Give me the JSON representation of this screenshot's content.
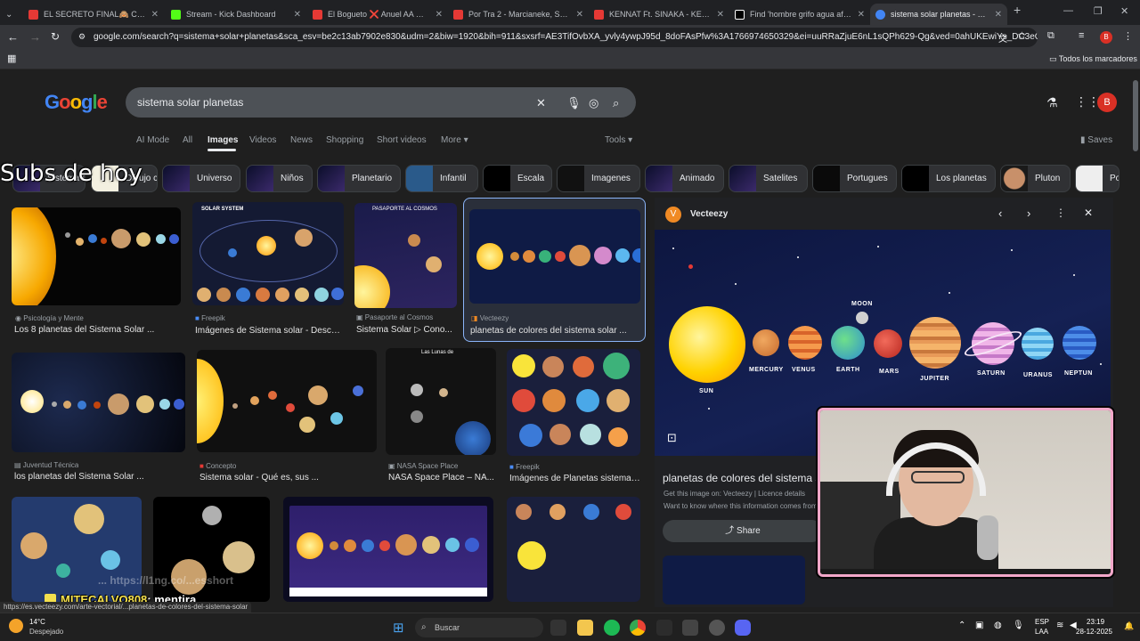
{
  "tabs": [
    {
      "title": "EL SECRETO FINAL🙈 Capítulo",
      "color": "#e53935"
    },
    {
      "title": "Stream - Kick Dashboard",
      "color": "#53fc18"
    },
    {
      "title": "El Bogueto ❌ Anuel AA ❌ Yu",
      "color": "#e53935"
    },
    {
      "title": "Por Tra 2 - Marcianeke, SexyZu",
      "color": "#e53935"
    },
    {
      "title": "KENNAT Ft. SINAKA - KE KE (Vi",
      "color": "#e53935"
    },
    {
      "title": "Find 'hombre grifo agua africa",
      "color": "#ffffff"
    },
    {
      "title": "sistema solar planetas - Google",
      "color": "#4285f4"
    }
  ],
  "url": "google.com/search?q=sistema+solar+planetas&sca_esv=be2c13ab7902e830&udm=2&biw=1920&bih=911&sxsrf=AE3TifOvbXA_yvly4ywpJ95d_8doFAsPfw%3A1766974650329&ei=uuRRaZjuE6nL1sQPh629-Qg&ved=0ahUKEwiYs_DC3eGRAxW...",
  "bookmarks_label": "Todos los marcadores",
  "logo": "Google",
  "search": {
    "query": "sistema solar planetas"
  },
  "nav": {
    "items": [
      "AI Mode",
      "All",
      "Images",
      "Videos",
      "News",
      "Shopping",
      "Short videos",
      "More"
    ],
    "tools": "Tools",
    "saves": "Saves"
  },
  "chips": [
    "Sistema solar",
    "Dibujo color",
    "Universo",
    "Niños",
    "Planetario",
    "Infantil",
    "Escala",
    "Imagenes",
    "Animado",
    "Satelites",
    "Portugues",
    "Los planetas",
    "Pluton",
    "Po"
  ],
  "results": [
    {
      "source": "Psicología y Mente",
      "caption": "Los 8 planetas del Sistema Solar ..."
    },
    {
      "source": "Freepik",
      "caption": "Imágenes de Sistema solar - Desca..."
    },
    {
      "source": "Pasaporte al Cosmos",
      "caption": "Sistema Solar ▷ Cono..."
    },
    {
      "source": "Vecteezy",
      "caption": "planetas de colores del sistema solar ..."
    },
    {
      "source": "Juventud Técnica",
      "caption": "los planetas del Sistema Solar ..."
    },
    {
      "source": "Concepto",
      "caption": "Sistema solar - Qué es, sus ..."
    },
    {
      "source": "NASA Space Place",
      "caption": "NASA Space Place – NA..."
    },
    {
      "source": "Freepik",
      "caption": "Imágenes de Planetas sistema ..."
    }
  ],
  "thumb_text": {
    "solar_system": "SOLAR SYSTEM",
    "pasaporte": "PASAPORTE AL COSMOS",
    "lunas": "Las Lunas de"
  },
  "panel": {
    "source": "Vecteezy",
    "title": "planetas de colores del sistema solar",
    "get_image": "Get this image on: Vecteezy | Licence details",
    "want_to_know": "Want to know where this information comes from",
    "share": "Share",
    "planet_labels": [
      "SUN",
      "MERCURY",
      "VENUS",
      "MOON",
      "EARTH",
      "MARS",
      "JUPITER",
      "SATURN",
      "URANUS",
      "NEPTUN"
    ]
  },
  "overlay": {
    "subs": "Subs de hoy",
    "chat_user": "MITECALVO808",
    "chat_msg": ": mentira",
    "faded_link": "... https://l1ng.co/...esshort"
  },
  "status_url": "https://es.vecteezy.com/arte-vectorial/...planetas-de-colores-del-sistema-solar",
  "taskbar": {
    "temp": "14°C",
    "weather": "Despejado",
    "search": "Buscar",
    "lang": "ESP",
    "lang2": "LAA",
    "time": "23:19",
    "date": "28-12-2025"
  },
  "colors": {
    "accent": "#8ab4f8",
    "avatar": "#d93025",
    "cam_frame": "#f2a7c9"
  }
}
